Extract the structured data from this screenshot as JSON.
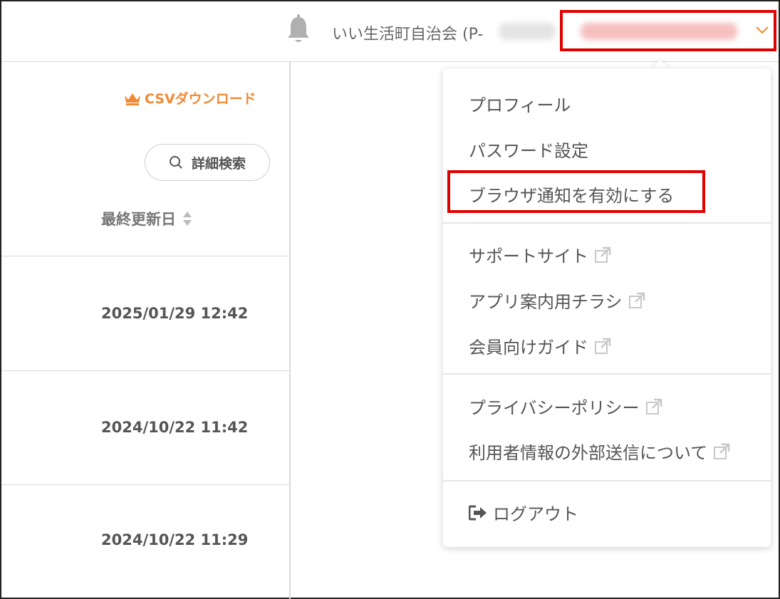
{
  "header": {
    "org_name": "いい生活町自治会 (P-",
    "user_menu": {
      "icon": "chevron-down-icon"
    },
    "notification": {
      "icon": "bell-icon"
    }
  },
  "toolbar": {
    "csv_download_label": "CSVダウンロード",
    "advanced_search_label": "詳細検索"
  },
  "table": {
    "columns": [
      {
        "label": "最終更新日",
        "sortable": true
      }
    ],
    "rows": [
      {
        "updated_at": "2025/01/29 12:42"
      },
      {
        "updated_at": "2024/10/22 11:42"
      },
      {
        "updated_at": "2024/10/22 11:29"
      }
    ]
  },
  "dropdown": {
    "groups": [
      {
        "items": [
          {
            "label": "プロフィール",
            "external": false
          },
          {
            "label": "パスワード設定",
            "external": false
          },
          {
            "label": "ブラウザ通知を有効にする",
            "external": false
          }
        ]
      },
      {
        "items": [
          {
            "label": "サポートサイト",
            "external": true
          },
          {
            "label": "アプリ案内用チラシ",
            "external": true
          },
          {
            "label": "会員向けガイド",
            "external": true
          }
        ]
      },
      {
        "items": [
          {
            "label": "プライバシーポリシー",
            "external": true
          },
          {
            "label": "利用者情報の外部送信について",
            "external": true
          }
        ]
      },
      {
        "items": [
          {
            "label": "ログアウト",
            "external": false
          }
        ]
      }
    ]
  },
  "colors": {
    "accent_orange": "#f08a34",
    "highlight_red": "#e00000",
    "text_gray": "#555555",
    "border_gray": "#d9d9d9"
  }
}
